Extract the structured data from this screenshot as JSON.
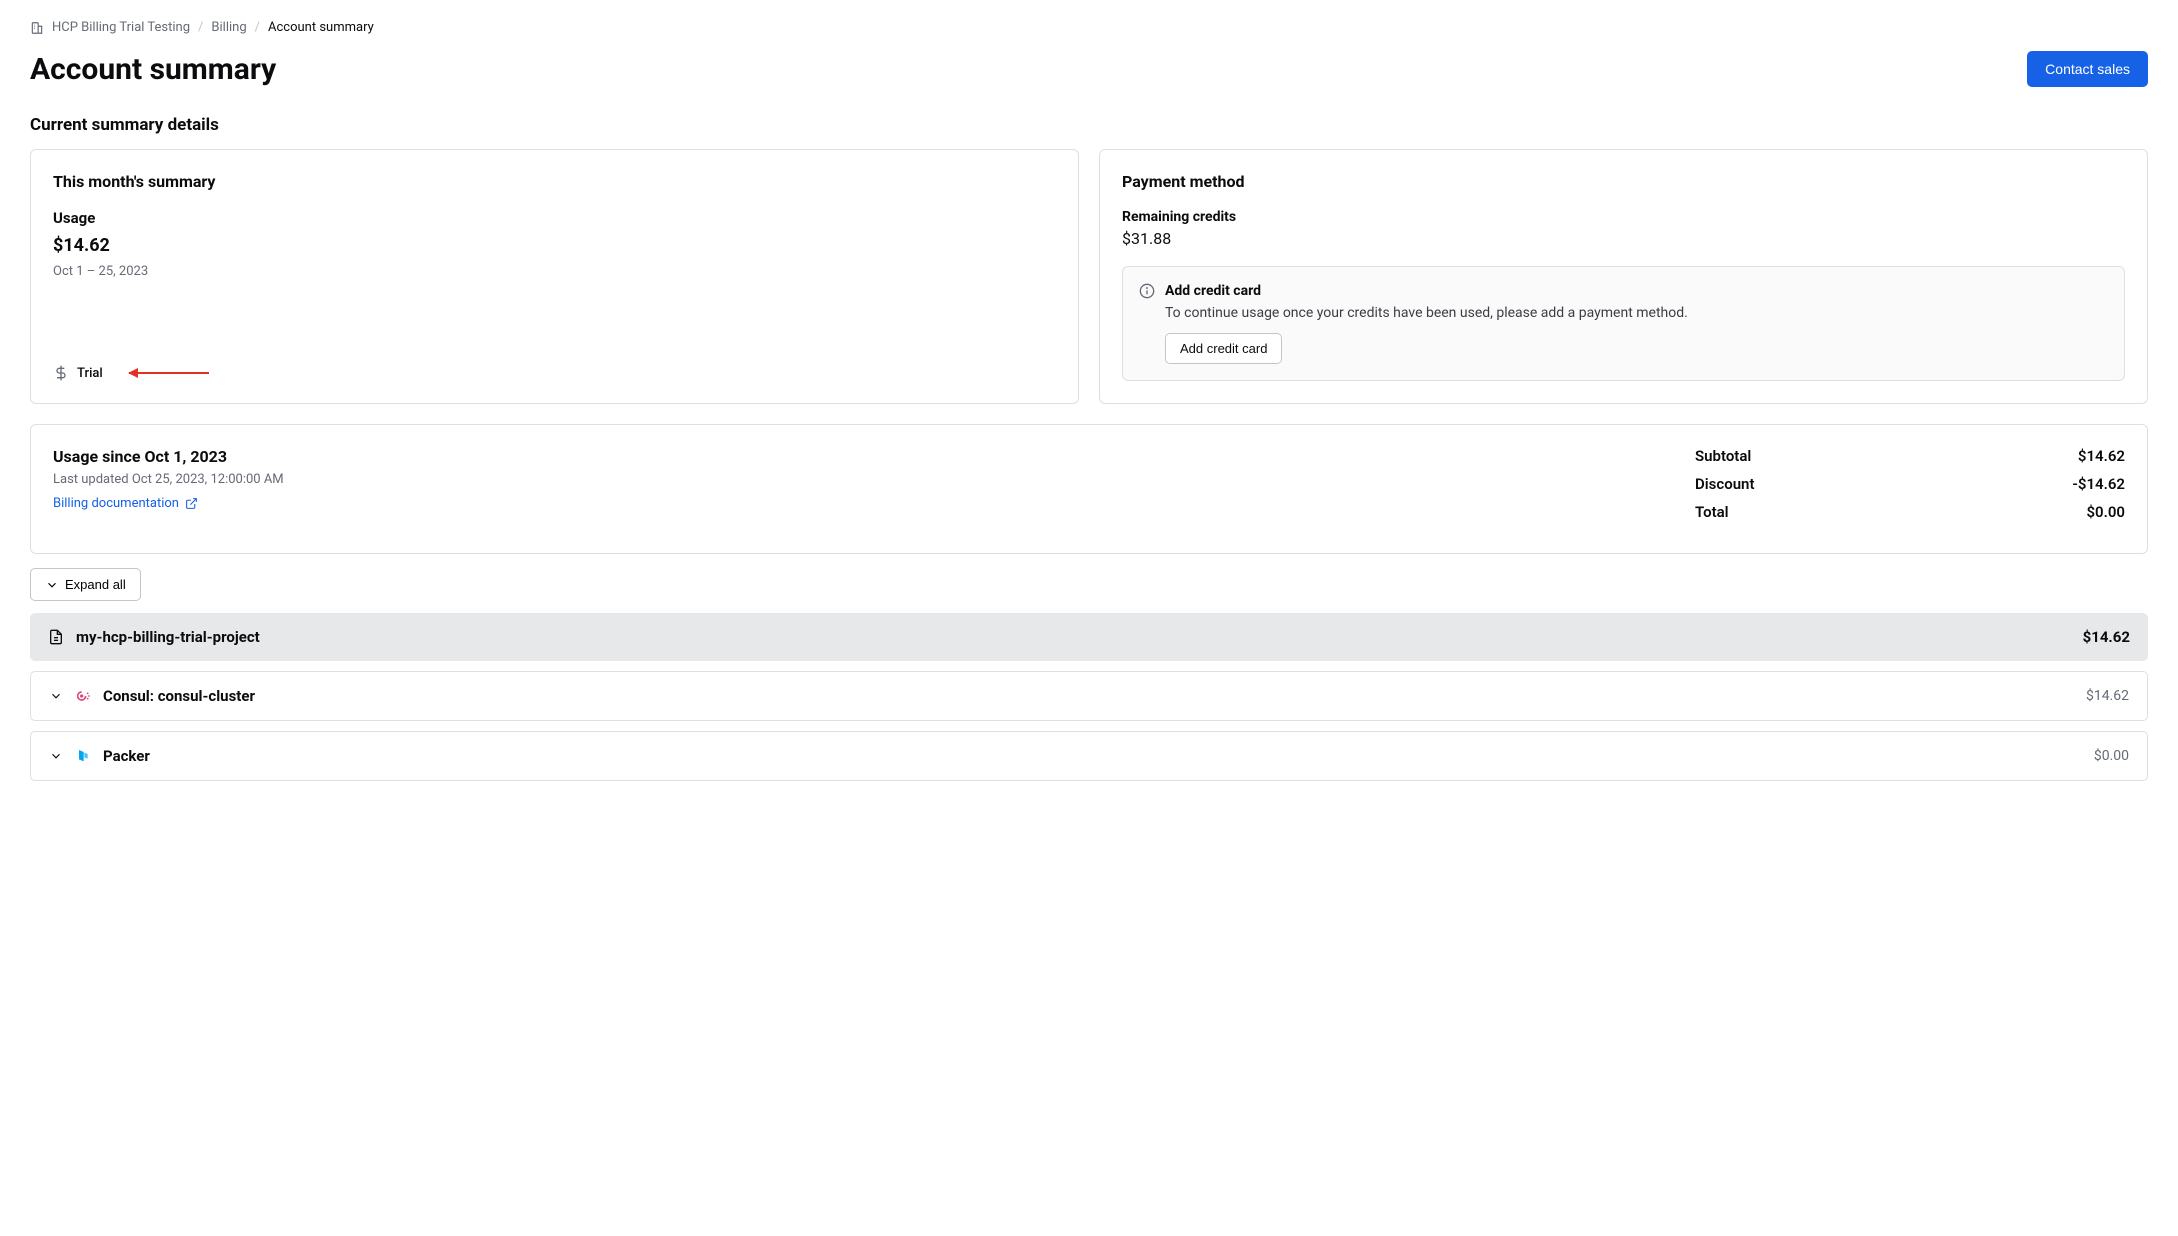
{
  "breadcrumb": {
    "org": "HCP Billing Trial Testing",
    "section": "Billing",
    "current": "Account summary"
  },
  "header": {
    "title": "Account summary",
    "contact_button": "Contact sales"
  },
  "section_title": "Current summary details",
  "month_card": {
    "title": "This month's summary",
    "usage_label": "Usage",
    "amount": "$14.62",
    "range": "Oct 1 – 25, 2023",
    "badge": "Trial"
  },
  "payment_card": {
    "title": "Payment method",
    "credits_label": "Remaining credits",
    "credits_amount": "$31.88",
    "alert_title": "Add credit card",
    "alert_body": "To continue usage once your credits have been used, please add a payment method.",
    "alert_button": "Add credit card"
  },
  "usage_block": {
    "title": "Usage since Oct 1, 2023",
    "last_updated": "Last updated Oct 25, 2023, 12:00:00 AM",
    "doc_link": "Billing documentation",
    "totals": {
      "subtotal_label": "Subtotal",
      "subtotal": "$14.62",
      "discount_label": "Discount",
      "discount": "-$14.62",
      "total_label": "Total",
      "total": "$0.00"
    }
  },
  "expand_button": "Expand all",
  "project": {
    "name": "my-hcp-billing-trial-project",
    "amount": "$14.62"
  },
  "services": [
    {
      "name": "Consul: consul-cluster",
      "amount": "$14.62"
    },
    {
      "name": "Packer",
      "amount": "$0.00"
    }
  ]
}
